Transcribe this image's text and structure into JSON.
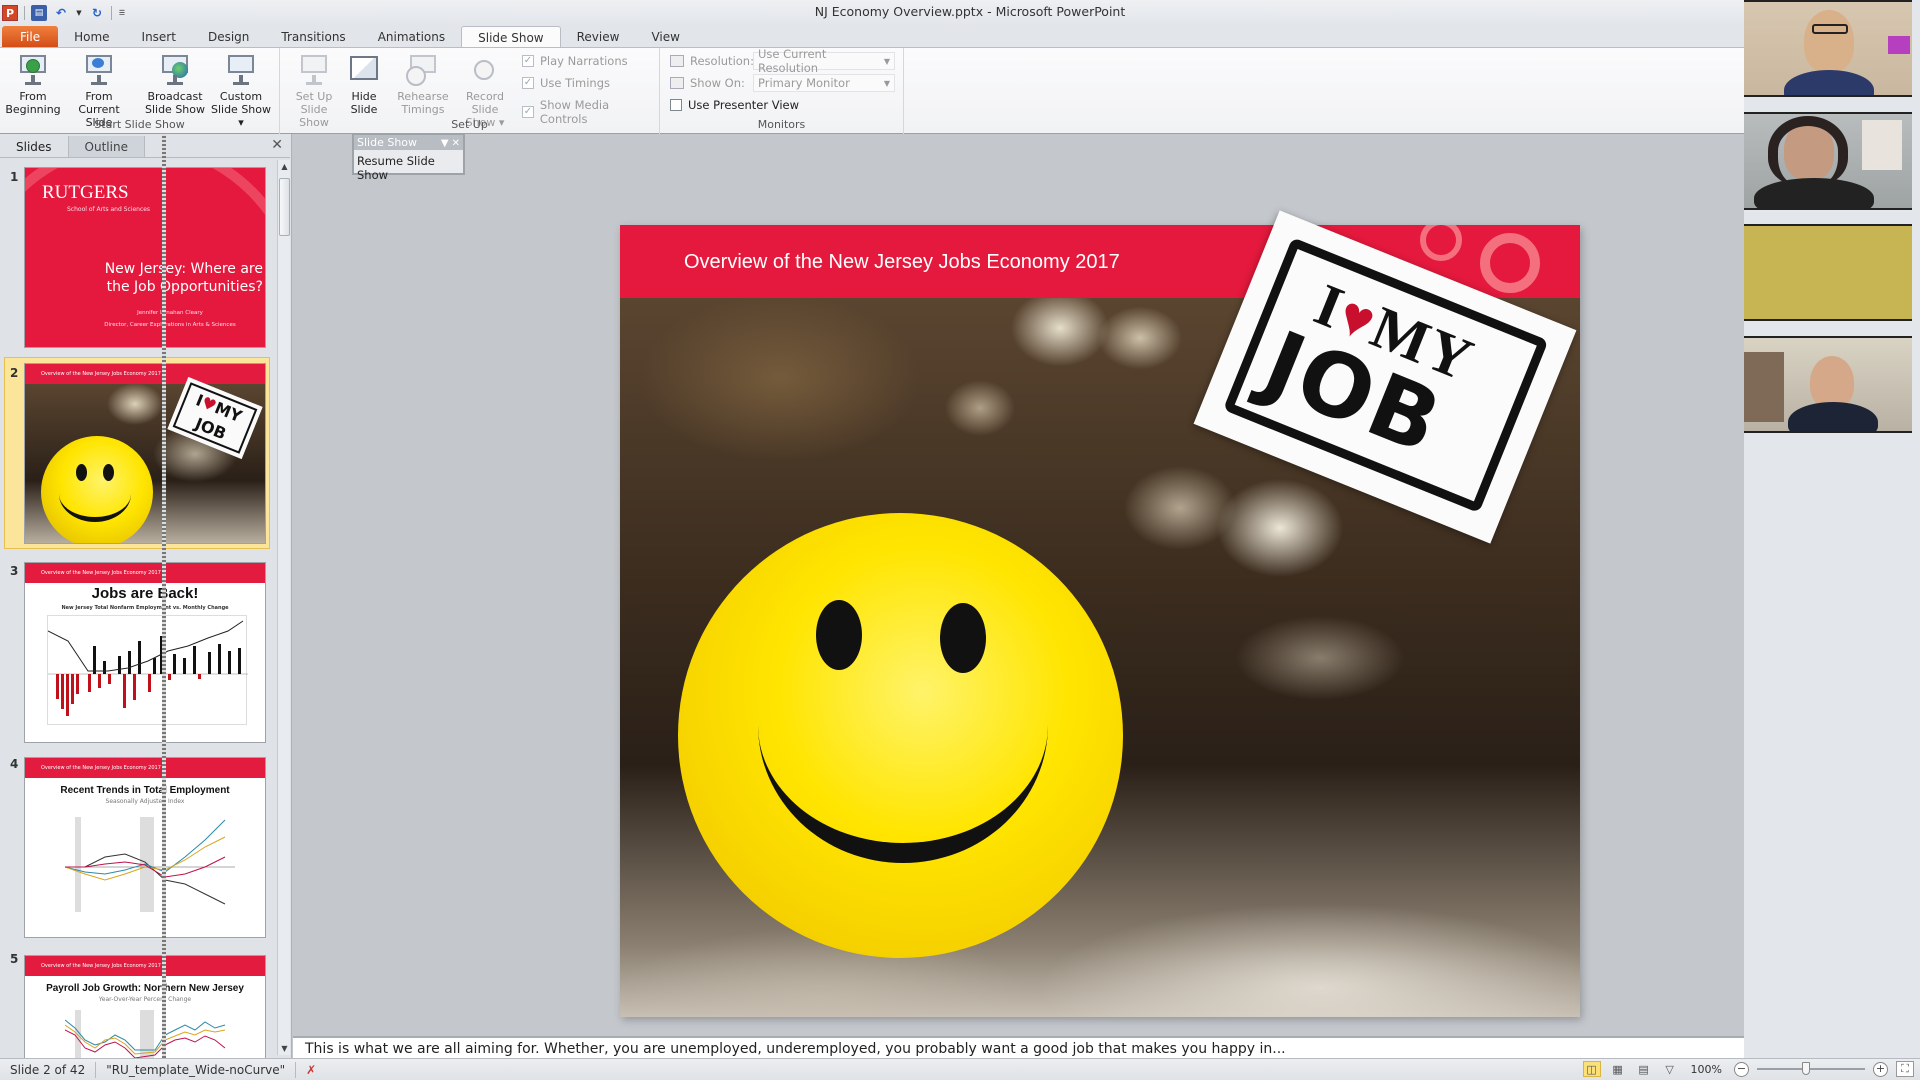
{
  "window": {
    "title": "NJ Economy Overview.pptx  -  Microsoft PowerPoint"
  },
  "quick_access": {
    "icons": [
      "powerpoint-logo-icon",
      "save-icon",
      "undo-icon",
      "redo-icon",
      "customize-icon"
    ],
    "logo_letter": "P"
  },
  "tabs": [
    {
      "label": "File"
    },
    {
      "label": "Home"
    },
    {
      "label": "Insert"
    },
    {
      "label": "Design"
    },
    {
      "label": "Transitions"
    },
    {
      "label": "Animations"
    },
    {
      "label": "Slide Show",
      "active": true
    },
    {
      "label": "Review"
    },
    {
      "label": "View"
    }
  ],
  "ribbon": {
    "groups": {
      "start": {
        "label": "Start Slide Show",
        "buttons": [
          {
            "line1": "From",
            "line2": "Beginning"
          },
          {
            "line1": "From",
            "line2": "Current Slide"
          },
          {
            "line1": "Broadcast",
            "line2": "Slide Show"
          },
          {
            "line1": "Custom",
            "line2": "Slide Show ▾"
          }
        ]
      },
      "setup": {
        "label": "Set Up",
        "buttons": [
          {
            "line1": "Set Up",
            "line2": "Slide Show",
            "disabled": true
          },
          {
            "line1": "Hide",
            "line2": "Slide"
          },
          {
            "line1": "Rehearse",
            "line2": "Timings",
            "disabled": true
          },
          {
            "line1": "Record Slide",
            "line2": "Show ▾",
            "disabled": true
          }
        ],
        "checks": [
          {
            "label": "Play Narrations",
            "checked": true
          },
          {
            "label": "Use Timings",
            "checked": true
          },
          {
            "label": "Show Media Controls",
            "checked": true
          }
        ]
      },
      "monitors": {
        "label": "Monitors",
        "resolution_label": "Resolution:",
        "resolution_value": "Use Current Resolution",
        "show_on_label": "Show On:",
        "show_on_value": "Primary Monitor",
        "presenter_view_label": "Use Presenter View",
        "presenter_view_checked": false
      }
    }
  },
  "left_pane": {
    "tabs": [
      "Slides",
      "Outline"
    ],
    "active_tab": "Slides",
    "selected_slide": 2,
    "thumbnails": [
      {
        "num": "1",
        "brand": "RUTGERS",
        "school": "School of Arts and Sciences",
        "title": "New Jersey: Where are the Job Opportunities?",
        "author": "Jennifer Lenahan Cleary",
        "role": "Director, Career Explorations in Arts & Sciences"
      },
      {
        "num": "2",
        "band": "Overview of the New Jersey Jobs Economy 2017"
      },
      {
        "num": "3",
        "band": "Overview of the New Jersey Jobs Economy 2017",
        "title": "Jobs are Back!",
        "subtitle": "New Jersey Total Nonfarm Employment vs. Monthly Change"
      },
      {
        "num": "4",
        "band": "Overview of the New Jersey Jobs Economy 2017",
        "title": "Recent Trends in Total Employment",
        "subtitle": "Seasonally Adjusted Index"
      },
      {
        "num": "5",
        "band": "Overview of the New Jersey Jobs Economy 2017",
        "title": "Payroll Job Growth: Northern New Jersey",
        "subtitle": "Year-Over-Year Percent Change"
      }
    ]
  },
  "floating_toolbar": {
    "title": "Slide Show",
    "item": "Resume Slide Show"
  },
  "slide": {
    "header": "Overview of the New Jersey Jobs Economy 2017",
    "sticker_line1_a": "I",
    "sticker_heart": "♥",
    "sticker_line1_b": "MY",
    "sticker_line2": "JOB",
    "colors": {
      "band": "#e4193d",
      "smiley": "#ffe500"
    }
  },
  "notes": {
    "text": "This is what we are all aiming for. Whether, you are unemployed, underemployed, you probably want a good job that makes you happy in..."
  },
  "status_bar": {
    "slide_indicator": "Slide 2 of 42",
    "theme": "\"RU_template_Wide-noCurve\"",
    "zoom": "100%",
    "zoom_fraction": 0.45
  },
  "video_participants": 4
}
